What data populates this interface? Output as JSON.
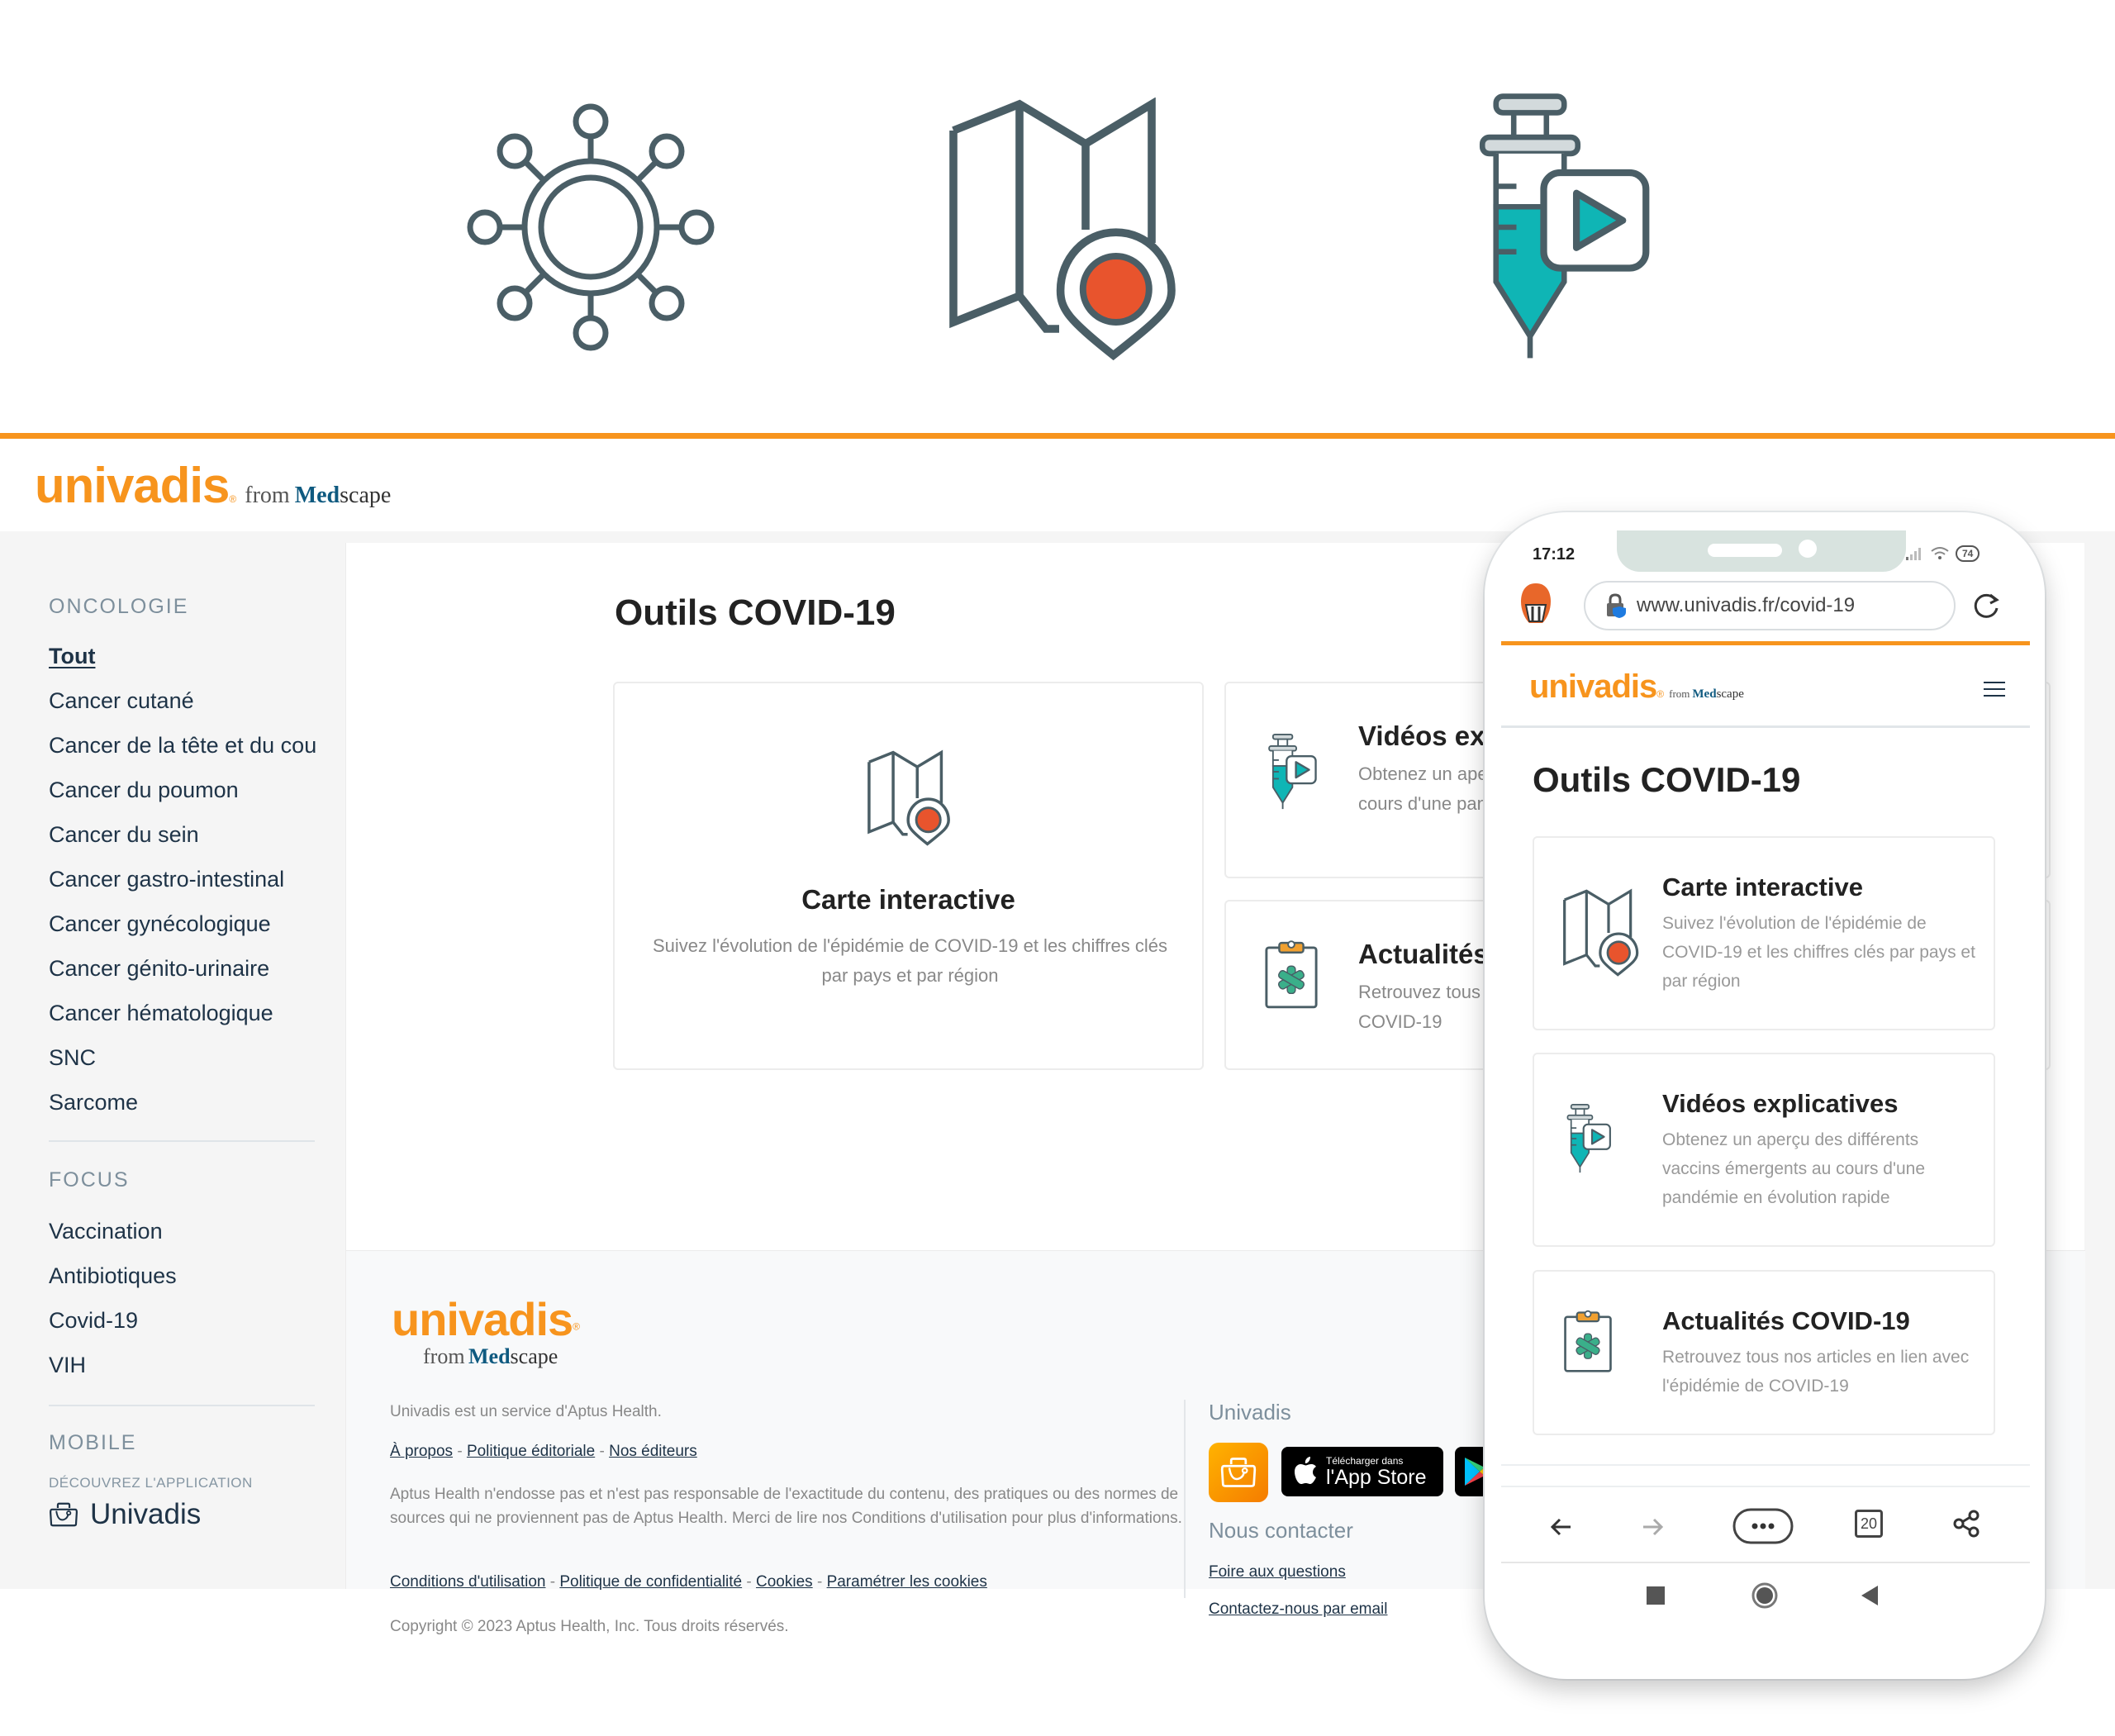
{
  "hero": {
    "icons": [
      "virus-icon",
      "map-pin-icon",
      "syringe-video-icon"
    ],
    "accent_orange": "#f7941d",
    "pin_red": "#e8542d",
    "teal": "#0fb5b5",
    "slate": "#4a5e66"
  },
  "brand": {
    "name": "univadis",
    "registered": "®",
    "from": "from",
    "med": "Med",
    "scape": "scape"
  },
  "sidebar": {
    "oncology_heading": "ONCOLOGIE",
    "oncology_items": [
      {
        "label": "Tout",
        "active": true
      },
      {
        "label": "Cancer cutané"
      },
      {
        "label": "Cancer de la tête et du cou"
      },
      {
        "label": "Cancer du poumon"
      },
      {
        "label": "Cancer du sein"
      },
      {
        "label": "Cancer gastro-intestinal"
      },
      {
        "label": "Cancer gynécologique"
      },
      {
        "label": "Cancer génito-urinaire"
      },
      {
        "label": "Cancer hématologique"
      },
      {
        "label": "SNC"
      },
      {
        "label": "Sarcome"
      }
    ],
    "focus_heading": "FOCUS",
    "focus_items": [
      {
        "label": "Vaccination"
      },
      {
        "label": "Antibiotiques"
      },
      {
        "label": "Covid-19"
      },
      {
        "label": "VIH"
      }
    ],
    "mobile_heading": "MOBILE",
    "mobile_sub": "DÉCOUVREZ L'APPLICATION",
    "mobile_app": "Univadis"
  },
  "main": {
    "title": "Outils COVID-19",
    "cards": [
      {
        "title": "Carte interactive",
        "desc": "Suivez l'évolution de l'épidémie de COVID-19 et les chiffres clés par pays et par région",
        "icon": "map-pin-icon"
      },
      {
        "title": "Vidéos explicatives",
        "desc": "Obtenez un aperçu des différents vaccins émergents au cours d'une pandémie en évolution rapide",
        "icon": "syringe-video-icon"
      },
      {
        "title": "Actualités COVID-19",
        "desc": "Retrouvez tous nos articles en lien avec l'épidémie de COVID-19",
        "icon": "clipboard-medical-icon"
      }
    ]
  },
  "footer": {
    "service": "Univadis est un service d'Aptus Health.",
    "links1": [
      "À propos",
      "Politique éditoriale",
      "Nos éditeurs"
    ],
    "disclaimer": "Aptus Health n'endosse pas et n'est pas responsable de l'exactitude du contenu, des pratiques ou des normes de sources qui ne proviennent pas de Aptus Health. Merci de lire nos Conditions d'utilisation pour plus d'informations.",
    "links2": [
      "Conditions d'utilisation",
      "Politique de confidentialité",
      "Cookies",
      "Paramétrer les cookies"
    ],
    "separator": "-",
    "copyright": "Copyright © 2023 Aptus Health, Inc. Tous droits réservés.",
    "app_heading": "Univadis",
    "appstore_small": "Télécharger dans",
    "appstore_big": "l'App Store",
    "contact_heading": "Nous contacter",
    "contact_links": [
      "Foire aux questions",
      "Contactez-nous par email"
    ]
  },
  "phone": {
    "time": "17:12",
    "battery": "74",
    "url": "www.univadis.fr/covid-19",
    "title": "Outils COVID-19",
    "cards": [
      {
        "title": "Carte interactive",
        "desc": "Suivez l'évolution de l'épidémie de COVID-19 et les chiffres clés par pays et par région"
      },
      {
        "title": "Vidéos explicatives",
        "desc": "Obtenez un aperçu des différents vaccins émergents au cours d'une pandémie en évolution rapide"
      },
      {
        "title": "Actualités COVID-19",
        "desc": "Retrouvez tous nos articles en lien avec l'épidémie de COVID-19"
      }
    ],
    "tab_count": "20"
  }
}
